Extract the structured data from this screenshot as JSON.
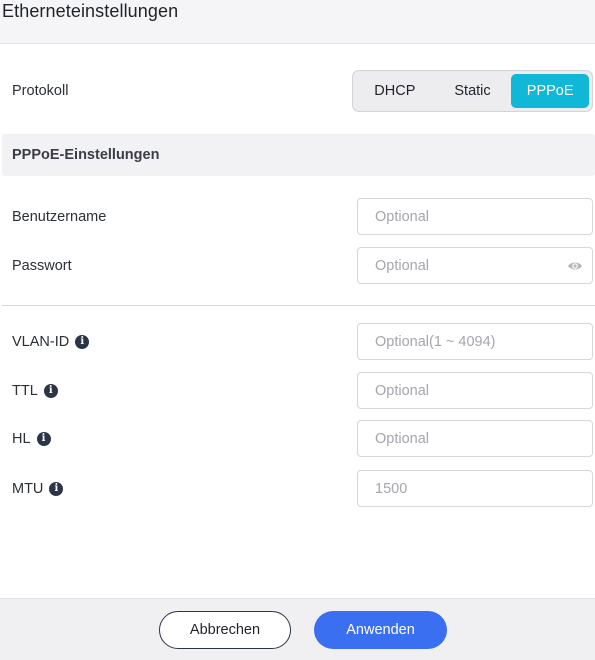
{
  "window": {
    "title": "Etherneteinstellungen"
  },
  "protocol": {
    "label": "Protokoll",
    "options": [
      "DHCP",
      "Static",
      "PPPoE"
    ],
    "selected": "PPPoE"
  },
  "pppoe_section": {
    "title": "PPPoE-Einstellungen",
    "username": {
      "label": "Benutzername",
      "value": "",
      "placeholder": "Optional"
    },
    "password": {
      "label": "Passwort",
      "value": "",
      "placeholder": "Optional",
      "icon": "eye-icon"
    }
  },
  "advanced": {
    "vlan_id": {
      "label": "VLAN-ID",
      "value": "",
      "placeholder": "Optional(1 ~ 4094)",
      "info_icon": "info-icon"
    },
    "ttl": {
      "label": "TTL",
      "value": "",
      "placeholder": "Optional",
      "info_icon": "info-icon"
    },
    "hl": {
      "label": "HL",
      "value": "",
      "placeholder": "Optional",
      "info_icon": "info-icon"
    },
    "mtu": {
      "label": "MTU",
      "value": "",
      "placeholder": "1500",
      "info_icon": "info-icon"
    }
  },
  "footer": {
    "cancel_label": "Abbrechen",
    "apply_label": "Anwenden"
  },
  "colors": {
    "accent_selected": "#11b7d6",
    "primary_button": "#3b6ff1"
  }
}
